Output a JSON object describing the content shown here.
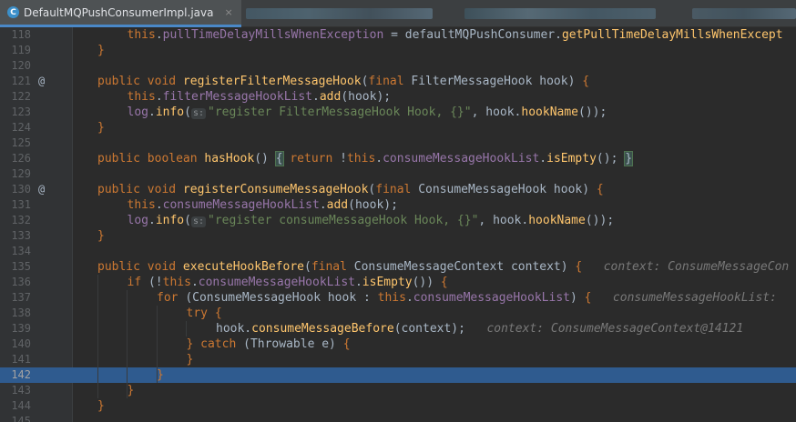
{
  "tabs": [
    {
      "label": "DefaultMQPushConsumerImpl.java",
      "close": "×",
      "icon": "java-class-icon"
    }
  ],
  "lines": [
    {
      "n": "118",
      "ind": 1,
      "toks": [
        [
          "this",
          "kw"
        ],
        [
          ".",
          ""
        ],
        [
          "pullTimeDelayMillsWhenException",
          "fld"
        ],
        [
          " = defaultMQPushConsumer.",
          ""
        ],
        [
          "getPullTimeDelayMillsWhenExcept",
          "mth"
        ]
      ]
    },
    {
      "n": "119",
      "ind": 0,
      "toks": [
        [
          "}",
          "br"
        ]
      ]
    },
    {
      "n": "120",
      "ind": 0,
      "toks": []
    },
    {
      "n": "121",
      "ann": "@",
      "ind": 0,
      "toks": [
        [
          "public void ",
          "kw"
        ],
        [
          "registerFilterMessageHook",
          "mth"
        ],
        [
          "(",
          ""
        ],
        [
          "final ",
          "kw"
        ],
        [
          "FilterMessageHook hook) ",
          ""
        ],
        [
          "{",
          "br"
        ]
      ]
    },
    {
      "n": "122",
      "ind": 1,
      "toks": [
        [
          "this",
          "kw"
        ],
        [
          ".",
          ""
        ],
        [
          "filterMessageHookList",
          "fld"
        ],
        [
          ".",
          ""
        ],
        [
          "add",
          "mth"
        ],
        [
          "(hook);",
          ""
        ]
      ]
    },
    {
      "n": "123",
      "ind": 1,
      "toks": [
        [
          "log",
          "fld"
        ],
        [
          ".",
          ""
        ],
        [
          "info",
          "mth"
        ],
        [
          "(",
          ""
        ],
        [
          "s:",
          "pill"
        ],
        [
          "\"register FilterMessageHook Hook, {}\"",
          "str"
        ],
        [
          ", hook.",
          ""
        ],
        [
          "hookName",
          "mth"
        ],
        [
          "());",
          ""
        ]
      ]
    },
    {
      "n": "124",
      "ind": 0,
      "toks": [
        [
          "}",
          "br"
        ]
      ]
    },
    {
      "n": "125",
      "ind": 0,
      "toks": []
    },
    {
      "n": "126",
      "ind": 0,
      "toks": [
        [
          "public boolean ",
          "kw"
        ],
        [
          "hasHook",
          "mth"
        ],
        [
          "() ",
          ""
        ],
        [
          "{",
          "hlbr"
        ],
        [
          " ",
          ""
        ],
        [
          "return ",
          "kw"
        ],
        [
          "!",
          ""
        ],
        [
          "this",
          "kw"
        ],
        [
          ".",
          ""
        ],
        [
          "consumeMessageHookList",
          "fld"
        ],
        [
          ".",
          ""
        ],
        [
          "isEmpty",
          "mth"
        ],
        [
          "(); ",
          ""
        ],
        [
          "}",
          "hlbr"
        ]
      ]
    },
    {
      "n": "129",
      "ind": 0,
      "toks": []
    },
    {
      "n": "130",
      "ann": "@",
      "ind": 0,
      "toks": [
        [
          "public void ",
          "kw"
        ],
        [
          "registerConsumeMessageHook",
          "mth"
        ],
        [
          "(",
          ""
        ],
        [
          "final ",
          "kw"
        ],
        [
          "ConsumeMessageHook hook) ",
          ""
        ],
        [
          "{",
          "br"
        ]
      ]
    },
    {
      "n": "131",
      "ind": 1,
      "toks": [
        [
          "this",
          "kw"
        ],
        [
          ".",
          ""
        ],
        [
          "consumeMessageHookList",
          "fld"
        ],
        [
          ".",
          ""
        ],
        [
          "add",
          "mth"
        ],
        [
          "(hook);",
          ""
        ]
      ]
    },
    {
      "n": "132",
      "ind": 1,
      "toks": [
        [
          "log",
          "fld"
        ],
        [
          ".",
          ""
        ],
        [
          "info",
          "mth"
        ],
        [
          "(",
          ""
        ],
        [
          "s:",
          "pill"
        ],
        [
          "\"register consumeMessageHook Hook, {}\"",
          "str"
        ],
        [
          ", hook.",
          ""
        ],
        [
          "hookName",
          "mth"
        ],
        [
          "());",
          ""
        ]
      ]
    },
    {
      "n": "133",
      "ind": 0,
      "toks": [
        [
          "}",
          "br"
        ]
      ]
    },
    {
      "n": "134",
      "ind": 0,
      "toks": []
    },
    {
      "n": "135",
      "ind": 0,
      "toks": [
        [
          "public void ",
          "kw"
        ],
        [
          "executeHookBefore",
          "mth"
        ],
        [
          "(",
          ""
        ],
        [
          "final ",
          "kw"
        ],
        [
          "ConsumeMessageContext context) ",
          ""
        ],
        [
          "{",
          "br"
        ],
        [
          "   context: ConsumeMessageCon",
          "hint"
        ]
      ]
    },
    {
      "n": "136",
      "ind": 1,
      "toks": [
        [
          "if ",
          "kw"
        ],
        [
          "(!",
          ""
        ],
        [
          "this",
          "kw"
        ],
        [
          ".",
          ""
        ],
        [
          "consumeMessageHookList",
          "fld"
        ],
        [
          ".",
          ""
        ],
        [
          "isEmpty",
          "mth"
        ],
        [
          "()) ",
          ""
        ],
        [
          "{",
          "br"
        ]
      ]
    },
    {
      "n": "137",
      "ind": 2,
      "toks": [
        [
          "for ",
          "kw"
        ],
        [
          "(ConsumeMessageHook hook : ",
          ""
        ],
        [
          "this",
          "kw"
        ],
        [
          ".",
          ""
        ],
        [
          "consumeMessageHookList",
          "fld"
        ],
        [
          ") ",
          ""
        ],
        [
          "{",
          "br"
        ],
        [
          "   consumeMessageHookList:",
          "hint"
        ]
      ]
    },
    {
      "n": "138",
      "ind": 3,
      "toks": [
        [
          "try ",
          "kw"
        ],
        [
          "{",
          "br"
        ]
      ]
    },
    {
      "n": "139",
      "ind": 4,
      "toks": [
        [
          "hook.",
          ""
        ],
        [
          "consumeMessageBefore",
          "mth"
        ],
        [
          "(context);",
          ""
        ],
        [
          "   context: ConsumeMessageContext@14121",
          "hint"
        ]
      ]
    },
    {
      "n": "140",
      "ind": 3,
      "toks": [
        [
          "} ",
          "br"
        ],
        [
          "catch ",
          "kw"
        ],
        [
          "(Throwable e) ",
          ""
        ],
        [
          "{",
          "br"
        ]
      ]
    },
    {
      "n": "141",
      "ind": 3,
      "toks": [
        [
          "}",
          "br"
        ]
      ]
    },
    {
      "n": "142",
      "ind": 2,
      "current": true,
      "toks": [
        [
          "}",
          "br"
        ]
      ]
    },
    {
      "n": "143",
      "ind": 1,
      "toks": [
        [
          "}",
          "br"
        ]
      ]
    },
    {
      "n": "144",
      "ind": 0,
      "toks": [
        [
          "}",
          "br"
        ]
      ]
    },
    {
      "n": "145",
      "ind": 0,
      "toks": []
    }
  ],
  "colors": {
    "keyword": "#cc7832",
    "field": "#9876aa",
    "method": "#ffc66d",
    "string": "#6a8759",
    "text": "#a9b7c6",
    "current_line": "#2f5b8f"
  }
}
